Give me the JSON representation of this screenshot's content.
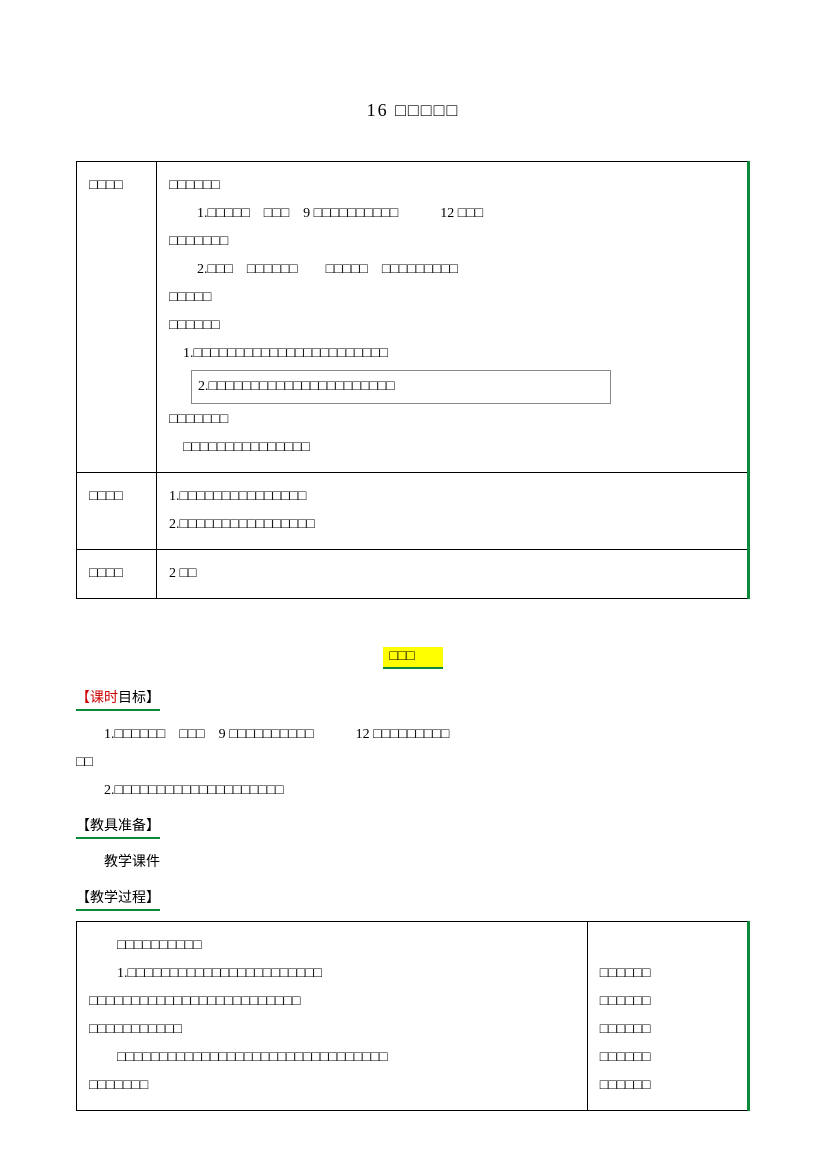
{
  "title": "16 □□□□□",
  "table1": {
    "row1": {
      "label": "□□□□",
      "group1_heading": "□□□□□□",
      "g1_line1": "1.□□□□□　□□□　9 □□□□□□□□□□　　　12 □□□",
      "g1_line1b": "□□□□□□□",
      "g1_line2": "2.□□□　□□□□□□　　□□□□□　□□□□□□□□□",
      "g1_line2b": "□□□□□",
      "group2_heading": "□□□□□□",
      "g2_item1": "1.□□□□□□□□□□□□□□□□□□□□□□□",
      "g2_item2": "2.□□□□□□□□□□□□□□□□□□□□□□",
      "group3_heading": "□□□□□□□",
      "g3_line": "□□□□□□□□□□□□□□□"
    },
    "row2": {
      "label": "□□□□",
      "line1": "1.□□□□□□□□□□□□□□□",
      "line2": "2.□□□□□□□□□□□□□□□□"
    },
    "row3": {
      "label": "□□□□",
      "value": "2 □□"
    }
  },
  "lesson_marker": "□□□",
  "sections": {
    "s1_prefix": "【课时",
    "s1_suffix": "目标】",
    "s1_body_l1": "1.□□□□□□　□□□　9 □□□□□□□□□□　　　12 □□□□□□□□□",
    "s1_body_l1b": "□□",
    "s1_body_l2": "2.□□□□□□□□□□□□□□□□□□□□",
    "s2_heading": "【教具准备】",
    "s2_body": "教学课件",
    "s3_heading": "【教学过程】"
  },
  "process": {
    "left": {
      "h": "□□□□□□□□□□",
      "l1": "1.□□□□□□□□□□□□□□□□□□□□□□□",
      "l2": "□□□□□□□□□□□□□□□□□□□□□□□□□",
      "l3": "□□□□□□□□□□□",
      "l4": "□□□□□□□□□□□□□□□□□□□□□□□□□□□□□□□□",
      "l5": "□□□□□□□"
    },
    "right": {
      "r1": "□□□□□□",
      "r2": "□□□□□□",
      "r3": "□□□□□□",
      "r4": "□□□□□□",
      "r5": "□□□□□□"
    }
  }
}
